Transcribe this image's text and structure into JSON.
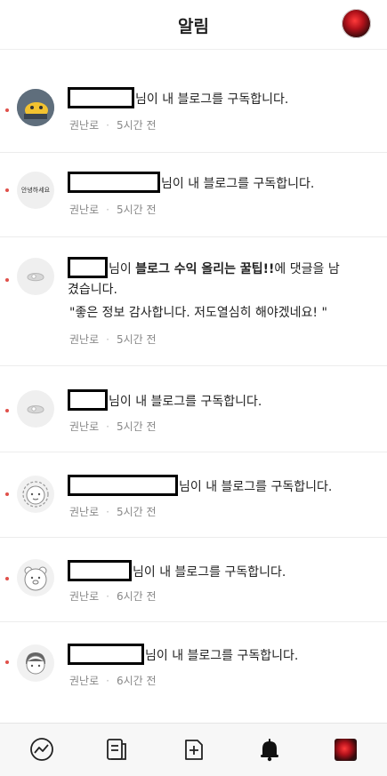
{
  "header": {
    "title": "알림"
  },
  "notifications": [
    {
      "avatar": "kakao-character-avatar",
      "action": "님이 내 블로그를 구독합니다.",
      "blog": "권난로",
      "time": "5시간 전"
    },
    {
      "avatar": "hello-text-avatar",
      "avatar_text": "안녕하세요",
      "action": "님이 내 블로그를 구독합니다.",
      "blog": "권난로",
      "time": "5시간 전"
    },
    {
      "avatar": "default-avatar",
      "action_prefix": "님이 ",
      "post_title": "블로그 수익 올리는 꿀팁!!",
      "action_suffix": "에 댓글을 남겼습니다.",
      "comment": "\"좋은 정보 감사합니다. 저도열심히 해야겠네요! \"",
      "blog": "권난로",
      "time": "5시간 전"
    },
    {
      "avatar": "default-avatar",
      "action": "님이 내 블로그를 구독합니다.",
      "blog": "권난로",
      "time": "5시간 전"
    },
    {
      "avatar": "lion-character-avatar",
      "action": "님이 내 블로그를 구독합니다.",
      "blog": "권난로",
      "time": "5시간 전"
    },
    {
      "avatar": "bear-character-avatar",
      "action": "님이 내 블로그를 구독합니다.",
      "blog": "권난로",
      "time": "6시간 전"
    },
    {
      "avatar": "girl-character-avatar",
      "action": "님이 내 블로그를 구독합니다.",
      "blog": "권난로",
      "time": "6시간 전"
    }
  ],
  "tabbar": {
    "items": [
      "stats-icon",
      "posts-icon",
      "new-post-icon",
      "notification-bell-icon",
      "profile-thumbnail"
    ],
    "active": "notification-bell-icon"
  },
  "colors": {
    "unread_dot": "#e0504a",
    "meta_text": "#888888"
  }
}
